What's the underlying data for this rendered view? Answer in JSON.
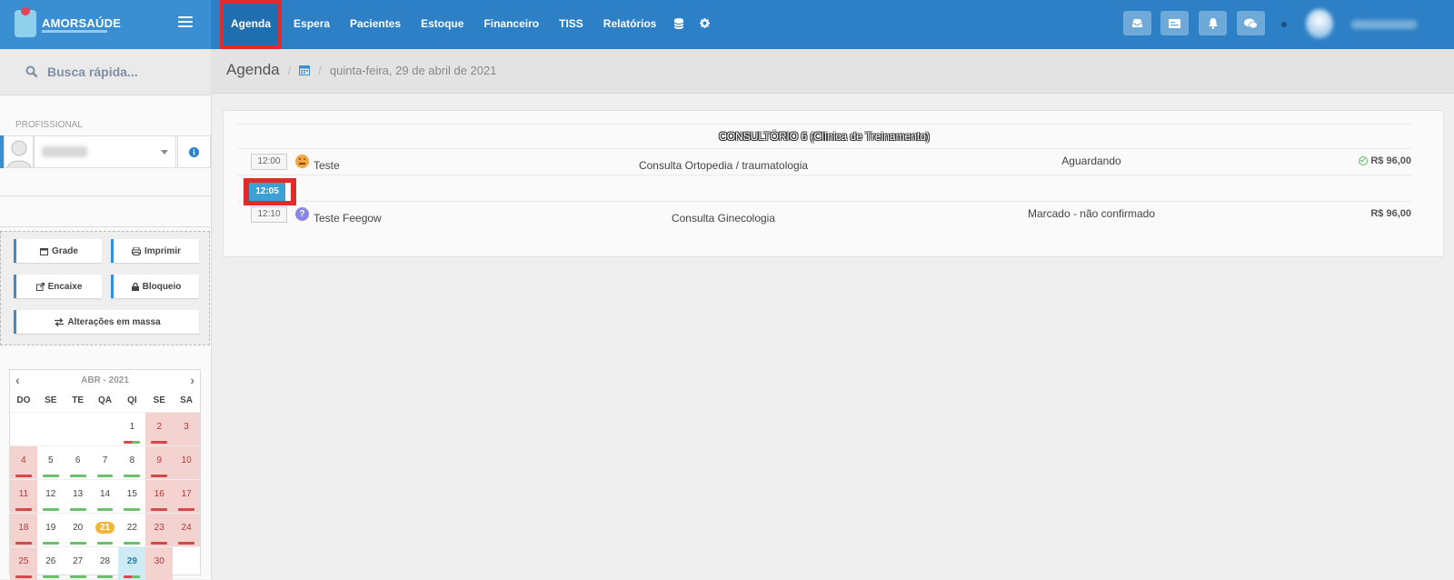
{
  "brand": {
    "name": "AMORSAÚDE"
  },
  "nav": {
    "items": [
      "Agenda",
      "Espera",
      "Pacientes",
      "Estoque",
      "Financeiro",
      "TISS",
      "Relatórios"
    ],
    "icons": [
      "database-icon",
      "gear-icon"
    ]
  },
  "topbar_icons": [
    "inbox-icon",
    "card-icon",
    "bell-icon",
    "chat-icon"
  ],
  "search": {
    "placeholder": "Busca rápida..."
  },
  "professional": {
    "label": "PROFISSIONAL"
  },
  "actions": {
    "grade": "Grade",
    "imprimir": "Imprimir",
    "encaixe": "Encaixe",
    "bloqueio": "Bloqueio",
    "alteracoes": "Alterações em massa"
  },
  "calendar": {
    "month_label": "ABR - 2021",
    "weekdays": [
      "DO",
      "SE",
      "TE",
      "QA",
      "QI",
      "SE",
      "SA"
    ],
    "weeks": [
      [
        null,
        null,
        null,
        null,
        1,
        2,
        3
      ],
      [
        4,
        5,
        6,
        7,
        8,
        9,
        10
      ],
      [
        11,
        12,
        13,
        14,
        15,
        16,
        17
      ],
      [
        18,
        19,
        20,
        21,
        22,
        23,
        24
      ],
      [
        25,
        26,
        27,
        28,
        29,
        30,
        null
      ]
    ],
    "selected_day": 21,
    "current_day": 29
  },
  "breadcrumb": {
    "title": "Agenda",
    "date": "quinta-feira, 29 de abril de 2021"
  },
  "schedule": {
    "room": "CONSULTÓRIO 6 (Clínica de Treinamento)",
    "rows": [
      {
        "time": "12:00",
        "patient": "Teste",
        "procedure": "Consulta Ortopedia / traumatologia",
        "status": "Aguardando",
        "price": "R$ 96,00",
        "icon": "sad-face-icon",
        "paid": true
      },
      {
        "time": "12:05",
        "free": true
      },
      {
        "time": "12:10",
        "patient": "Teste Feegow",
        "procedure": "Consulta Ginecologia",
        "status": "Marcado - não confirmado",
        "price": "R$ 96,00",
        "icon": "question-icon",
        "paid": false
      }
    ]
  },
  "colors": {
    "topbar": "#2d80c5",
    "accent": "#3a8fd3",
    "highlight": "#e22a2a"
  }
}
